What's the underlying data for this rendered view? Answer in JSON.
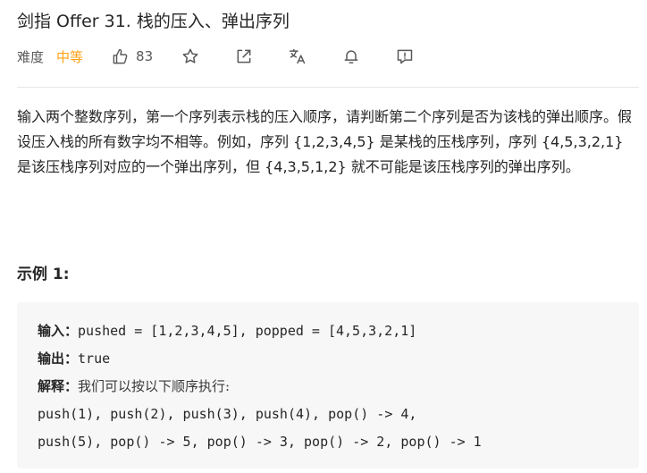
{
  "problem": {
    "title": "剑指 Offer 31. 栈的压入、弹出序列",
    "difficulty_label": "难度",
    "difficulty_value": "中等",
    "like_count": "83",
    "colors": {
      "difficulty_medium": "#ffa116",
      "text": "#262626",
      "secondary": "#595959",
      "code_background": "#f7f7f8"
    },
    "toolbar_icons": [
      "thumbs-up-icon",
      "star-icon",
      "share-icon",
      "translate-icon",
      "bell-icon",
      "feedback-icon"
    ]
  },
  "description": "输入两个整数序列，第一个序列表示栈的压入顺序，请判断第二个序列是否为该栈的弹出顺序。假设压入栈的所有数字均不相等。例如，序列 {1,2,3,4,5} 是某栈的压栈序列，序列 {4,5,3,2,1} 是该压栈序列对应的一个弹出序列，但 {4,3,5,1,2} 就不可能是该压栈序列的弹出序列。",
  "example": {
    "title": "示例 1:",
    "input_label": "输入：",
    "input_value": "pushed = [1,2,3,4,5], popped = [4,5,3,2,1]",
    "output_label": "输出：",
    "output_value": "true",
    "explanation_label": "解释：",
    "explanation_text": "我们可以按以下顺序执行:",
    "steps_line1": "push(1), push(2), push(3), push(4), pop() -> 4,",
    "steps_line2": "push(5), pop() -> 5, pop() -> 3, pop() -> 2, pop() -> 1"
  }
}
